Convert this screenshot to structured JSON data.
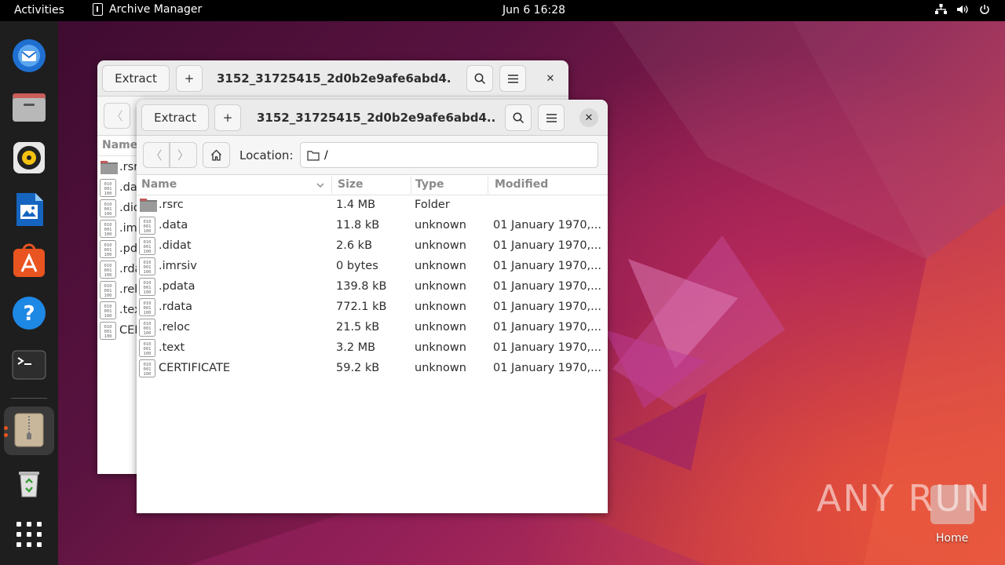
{
  "topbar": {
    "activities": "Activities",
    "app_name": "Archive Manager",
    "clock": "Jun 6  16:28"
  },
  "dock": {
    "items": [
      "thunderbird-icon",
      "files-icon",
      "rhythmbox-icon",
      "writer-icon",
      "app-center-icon",
      "help-icon",
      "terminal-icon",
      "archive-manager-icon",
      "trash-icon",
      "show-apps-icon"
    ]
  },
  "back_window": {
    "extract_label": "Extract",
    "title": "3152_31725415_2d0b2e9afe6abd4...",
    "col_name": "Name",
    "rows": [
      ".rsrc",
      ".data",
      ".didat",
      ".imrsiv",
      ".pdata",
      ".rdata",
      ".reloc",
      ".text",
      "CERTIFICATE"
    ]
  },
  "front_window": {
    "extract_label": "Extract",
    "add_label": "+",
    "title": "3152_31725415_2d0b2e9afe6abd4...",
    "location_label": "Location:",
    "location_value": "/",
    "columns": {
      "name": "Name",
      "size": "Size",
      "type": "Type",
      "modified": "Modified"
    },
    "rows": [
      {
        "name": ".rsrc",
        "size": "1.4 MB",
        "type": "Folder",
        "modified": "",
        "kind": "folder"
      },
      {
        "name": ".data",
        "size": "11.8 kB",
        "type": "unknown",
        "modified": "01 January 1970,...",
        "kind": "binary"
      },
      {
        "name": ".didat",
        "size": "2.6 kB",
        "type": "unknown",
        "modified": "01 January 1970,...",
        "kind": "binary"
      },
      {
        "name": ".imrsiv",
        "size": "0 bytes",
        "type": "unknown",
        "modified": "01 January 1970,...",
        "kind": "binary"
      },
      {
        "name": ".pdata",
        "size": "139.8 kB",
        "type": "unknown",
        "modified": "01 January 1970,...",
        "kind": "binary"
      },
      {
        "name": ".rdata",
        "size": "772.1 kB",
        "type": "unknown",
        "modified": "01 January 1970,...",
        "kind": "binary"
      },
      {
        "name": ".reloc",
        "size": "21.5 kB",
        "type": "unknown",
        "modified": "01 January 1970,...",
        "kind": "binary"
      },
      {
        "name": ".text",
        "size": "3.2 MB",
        "type": "unknown",
        "modified": "01 January 1970,...",
        "kind": "binary"
      },
      {
        "name": "CERTIFICATE",
        "size": "59.2 kB",
        "type": "unknown",
        "modified": "01 January 1970,...",
        "kind": "binary"
      }
    ]
  },
  "desktop": {
    "watermark": "ANY RUN",
    "home_label": "Home"
  }
}
